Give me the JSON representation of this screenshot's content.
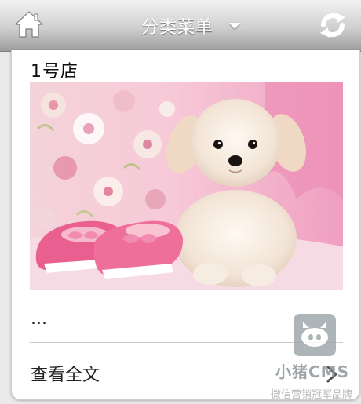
{
  "header": {
    "home_icon": "home-icon",
    "menu_label": "分类菜单",
    "menu_caret_icon": "caret-down-icon",
    "refresh_icon": "refresh-icon"
  },
  "article": {
    "title": "1号店",
    "summary": "...",
    "read_more": "查看全文",
    "read_more_icon": "chevron-right-icon"
  },
  "watermark": {
    "name": "小猪CMS",
    "tagline": "微信营销冠军品牌"
  },
  "colors": {
    "header_top": "#f3f3f3",
    "header_bottom": "#9c9c9c",
    "card_bg": "#ffffff",
    "page_bg": "#e9e9e9",
    "divider": "#cccccc"
  }
}
